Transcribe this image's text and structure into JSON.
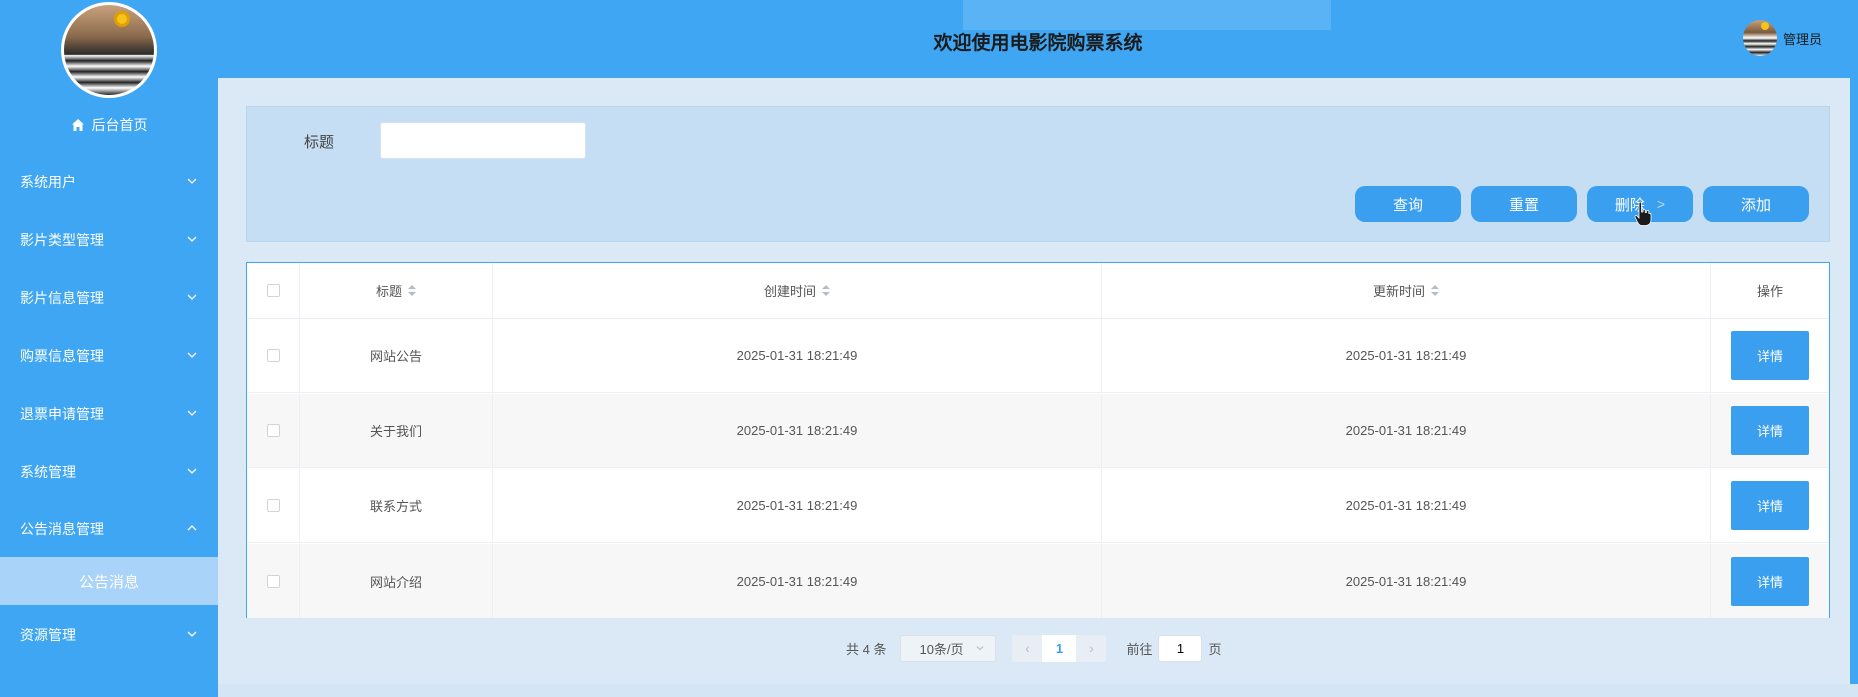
{
  "sidebar": {
    "home_label": "后台首页",
    "menus": [
      {
        "label": "系统用户",
        "expanded": false
      },
      {
        "label": "影片类型管理",
        "expanded": false
      },
      {
        "label": "影片信息管理",
        "expanded": false
      },
      {
        "label": "购票信息管理",
        "expanded": false
      },
      {
        "label": "退票申请管理",
        "expanded": false
      },
      {
        "label": "系统管理",
        "expanded": false
      },
      {
        "label": "公告消息管理",
        "expanded": true
      },
      {
        "label": "资源管理",
        "expanded": false
      }
    ],
    "active_submenu": "公告消息"
  },
  "header": {
    "title": "欢迎使用电影院购票系统",
    "user_label": "管理员"
  },
  "search": {
    "title_label": "标题",
    "title_value": "",
    "buttons": {
      "query": "查询",
      "reset": "重置",
      "delete": "删除",
      "delete_arrow": ">",
      "add": "添加"
    }
  },
  "table": {
    "columns": [
      "标题",
      "创建时间",
      "更新时间",
      "操作"
    ],
    "rows": [
      {
        "title": "网站公告",
        "created": "2025-01-31 18:21:49",
        "updated": "2025-01-31 18:21:49",
        "action": "详情"
      },
      {
        "title": "关于我们",
        "created": "2025-01-31 18:21:49",
        "updated": "2025-01-31 18:21:49",
        "action": "详情"
      },
      {
        "title": "联系方式",
        "created": "2025-01-31 18:21:49",
        "updated": "2025-01-31 18:21:49",
        "action": "详情"
      },
      {
        "title": "网站介绍",
        "created": "2025-01-31 18:21:49",
        "updated": "2025-01-31 18:21:49",
        "action": "详情"
      }
    ]
  },
  "pagination": {
    "total_text": "共 4 条",
    "page_size": "10条/页",
    "current_page": "1",
    "goto_prefix": "前往",
    "goto_value": "1",
    "goto_suffix": "页"
  },
  "colors": {
    "primary": "#3ea6f2",
    "button": "#3b9ff0",
    "active_submenu_bg": "#a9d3f8"
  }
}
